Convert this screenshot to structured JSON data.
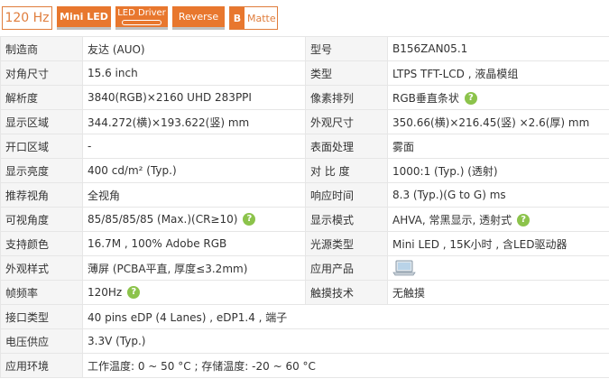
{
  "badges": {
    "hz": "120 Hz",
    "mini_led": "Mini LED",
    "led_driver": "LED Driver",
    "reverse": "Reverse",
    "matte_letter": "B",
    "matte": "Matte"
  },
  "help_glyph": "?",
  "rows": [
    {
      "l1": "制造商",
      "v1": "友达 (AUO)",
      "l2": "型号",
      "v2": "B156ZAN05.1"
    },
    {
      "l1": "对角尺寸",
      "v1": "15.6 inch",
      "l2": "类型",
      "v2": "LTPS TFT-LCD , 液晶模组"
    },
    {
      "l1": "解析度",
      "v1": "3840(RGB)×2160   UHD   283PPI",
      "l2": "像素排列",
      "v2": "RGB垂直条状"
    },
    {
      "l1": "显示区域",
      "v1": "344.272(横)×193.622(竖) mm",
      "l2": "外观尺寸",
      "v2": "350.66(横)×216.45(竖) ×2.6(厚) mm"
    },
    {
      "l1": "开口区域",
      "v1": "-",
      "l2": "表面处理",
      "v2": "雾面"
    },
    {
      "l1": "显示亮度",
      "v1": "400 cd/m² (Typ.)",
      "l2": "对 比 度",
      "v2": "1000:1 (Typ.) (透射)"
    },
    {
      "l1": "推荐视角",
      "v1": "全视角",
      "l2": "响应时间",
      "v2": "8.3 (Typ.)(G to G) ms"
    },
    {
      "l1": "可视角度",
      "v1": "85/85/85/85 (Max.)(CR≥10)",
      "l2": "显示模式",
      "v2": "AHVA, 常黑显示, 透射式"
    },
    {
      "l1": "支持颜色",
      "v1": "16.7M , 100% Adobe RGB",
      "l2": "光源类型",
      "v2": "Mini LED , 15K小时 , 含LED驱动器"
    },
    {
      "l1": "外观样式",
      "v1": "薄屏 (PCBA平直, 厚度≤3.2mm)",
      "l2": "应用产品",
      "v2": ""
    },
    {
      "l1": "帧频率",
      "v1": "120Hz",
      "l2": "触摸技术",
      "v2": "无触摸"
    },
    {
      "l1": "接口类型",
      "v1": "40 pins   eDP (4 Lanes) , eDP1.4 , 端子"
    },
    {
      "l1": "电压供应",
      "v1": "3.3V (Typ.)"
    },
    {
      "l1": "应用环境",
      "v1": "工作温度: 0 ~ 50 °C ; 存储温度: -20 ~ 60 °C"
    }
  ]
}
